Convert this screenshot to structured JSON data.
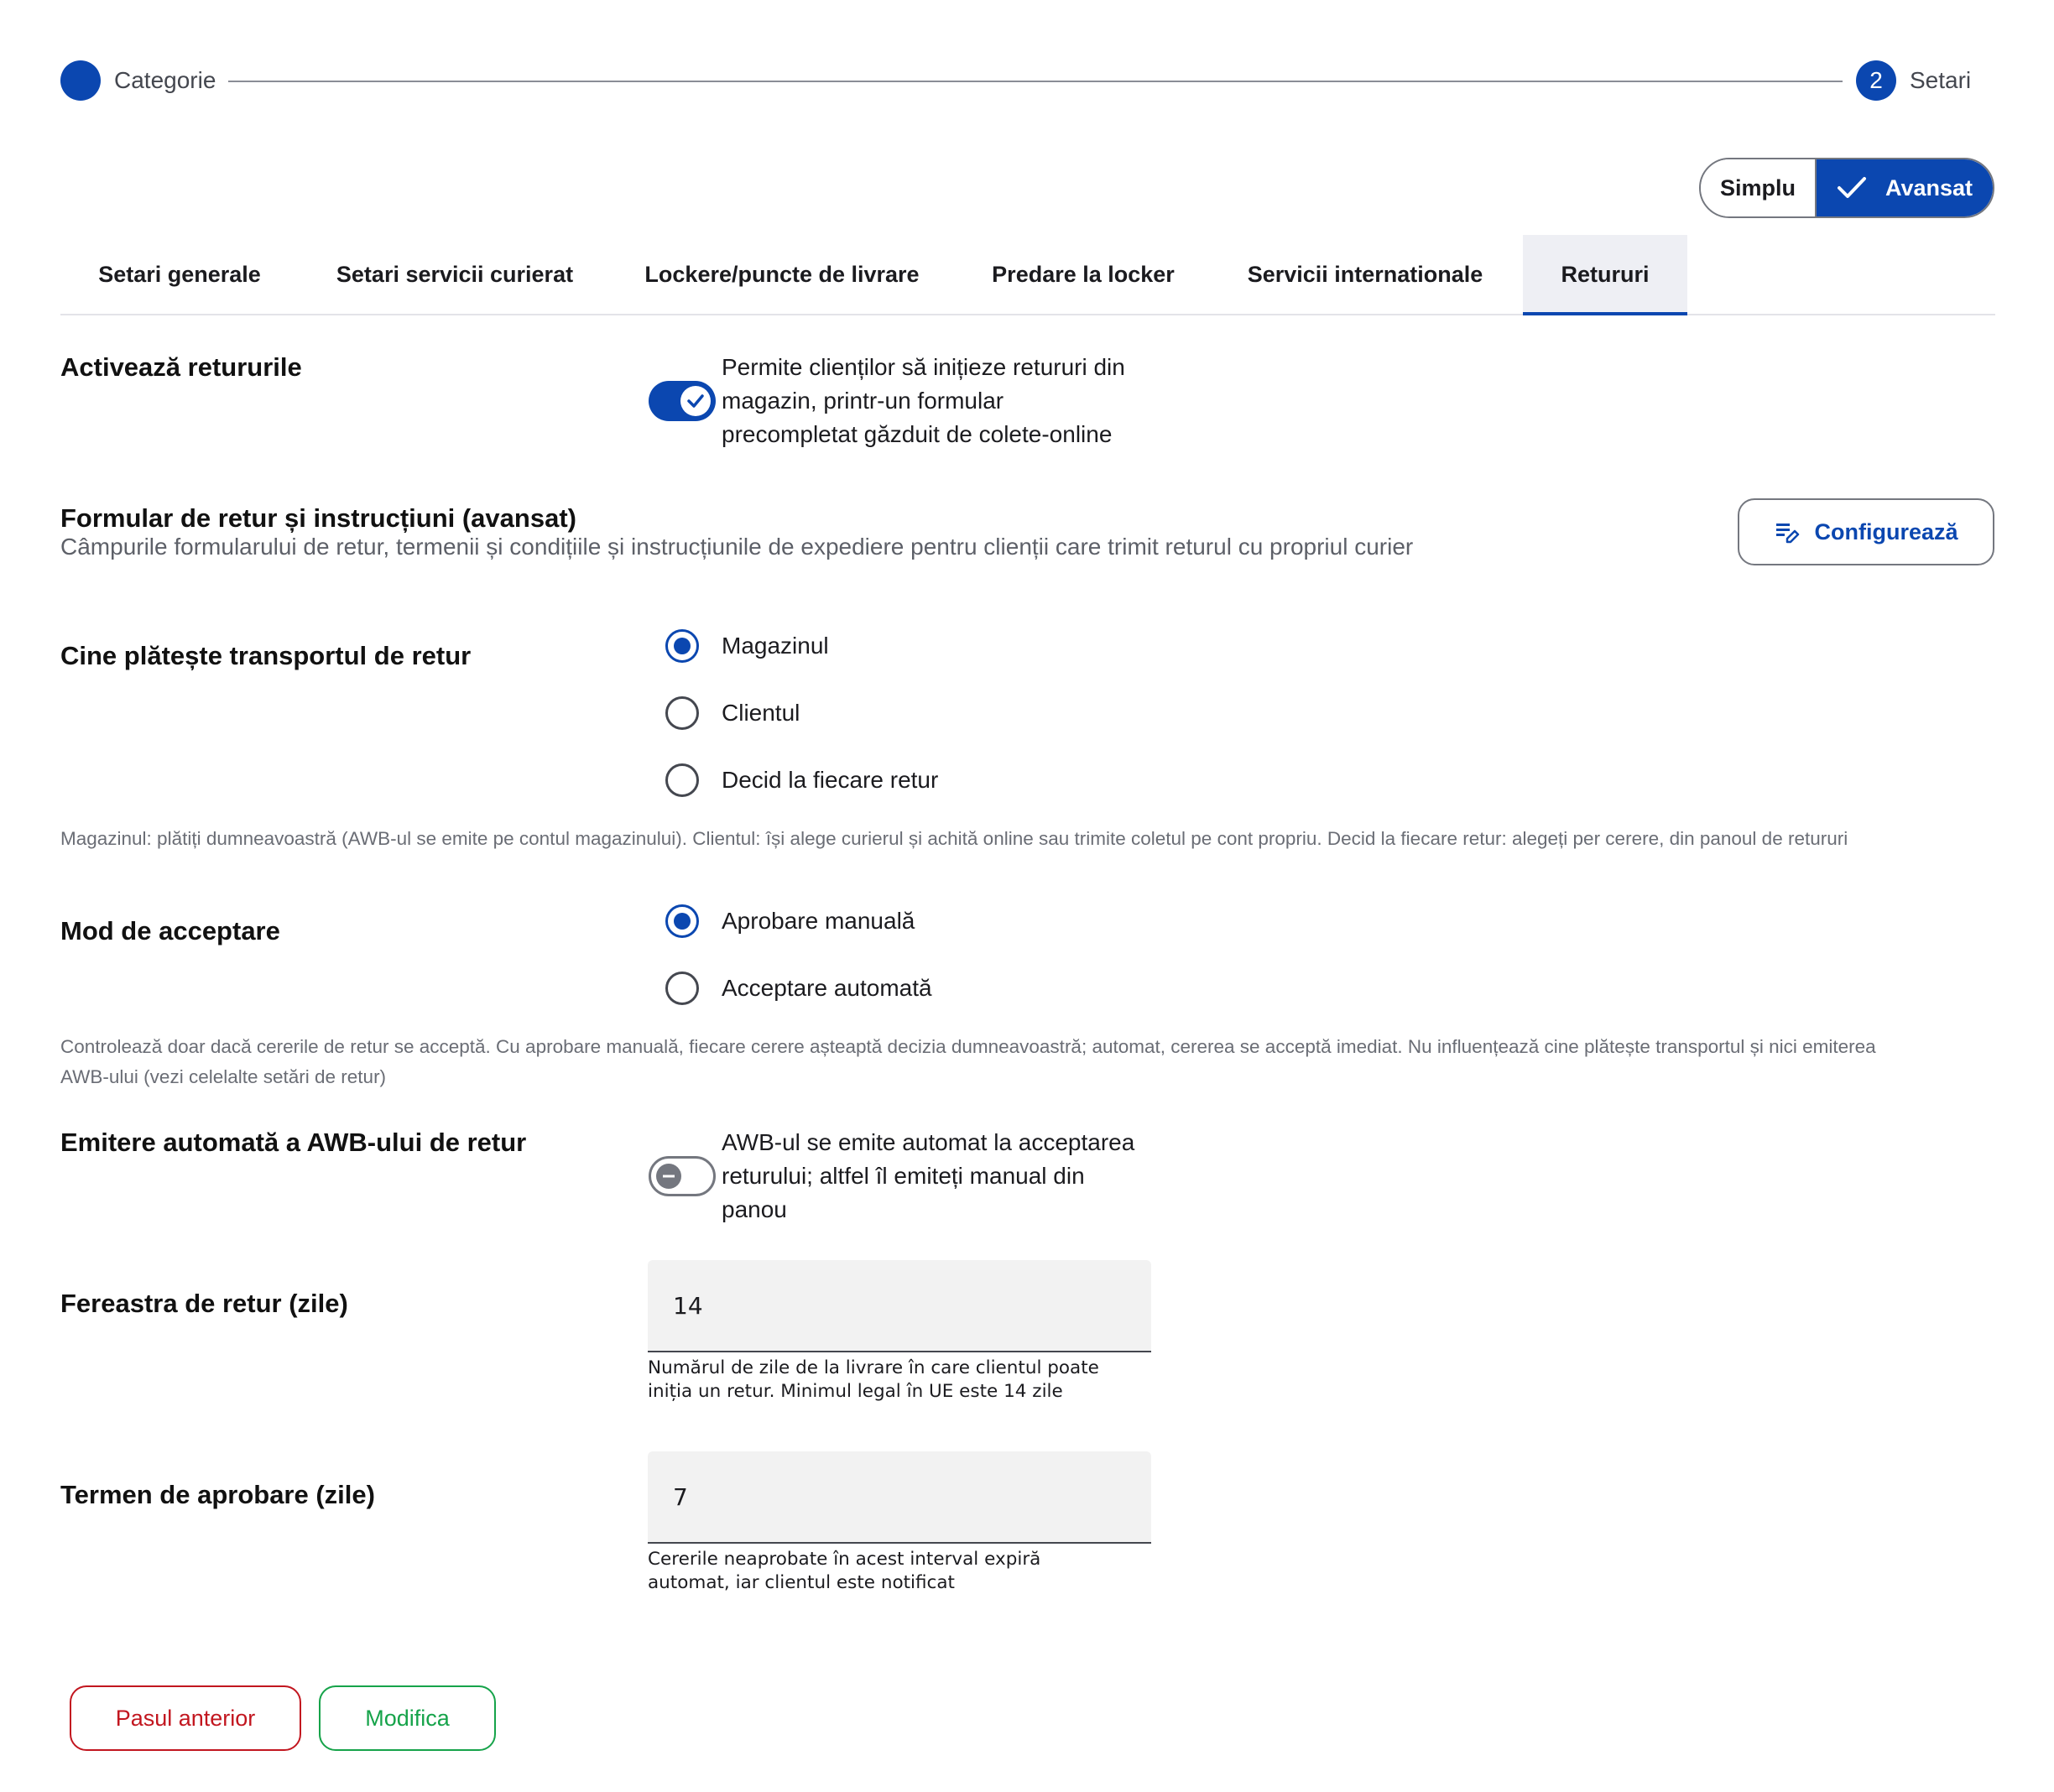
{
  "stepper": {
    "step1_label": "Categorie",
    "step2_number": "2",
    "step2_label": "Setari"
  },
  "mode_toggle": {
    "simple_label": "Simplu",
    "advanced_label": "Avansat",
    "selected": "Avansat"
  },
  "tabs": [
    {
      "label": "Setari generale",
      "active": false
    },
    {
      "label": "Setari servicii curierat",
      "active": false
    },
    {
      "label": "Lockere/puncte de livrare",
      "active": false
    },
    {
      "label": "Predare la locker",
      "active": false
    },
    {
      "label": "Servicii internationale",
      "active": false
    },
    {
      "label": "Retururi",
      "active": true
    }
  ],
  "enable_returns": {
    "title": "Activează retururile",
    "enabled": true,
    "description_lines": [
      "Permite clienților să inițieze retururi din",
      "magazin, printr-un formular",
      "precompletat găzduit de colete-online"
    ]
  },
  "return_form": {
    "title": "Formular de retur și instrucțiuni (avansat)",
    "description": "Câmpurile formularului de retur, termenii și condițiile și instrucțiunile de expediere pentru clienții care trimit returul cu propriul curier",
    "configure_button": "Configurează"
  },
  "shipping_payer": {
    "title": "Cine plătește transportul de retur",
    "options": [
      "Magazinul",
      "Clientul",
      "Decid la fiecare retur"
    ],
    "selected_index": 0,
    "help": "Magazinul: plătiți dumneavoastră (AWB-ul se emite pe contul magazinului). Clientul: își alege curierul și achită online sau trimite coletul pe cont propriu. Decid la fiecare retur: alegeți per cerere, din panoul de retururi"
  },
  "acceptance_mode": {
    "title": "Mod de acceptare",
    "options": [
      "Aprobare manuală",
      "Acceptare automată"
    ],
    "selected_index": 0,
    "help_lines": [
      "Controlează doar dacă cererile de retur se acceptă. Cu aprobare manuală, fiecare cerere așteaptă decizia dumneavoastră; automat, cererea se acceptă imediat. Nu influențează cine plătește transportul și nici emiterea",
      "AWB-ului (vezi celelalte setări de retur)"
    ]
  },
  "auto_awb": {
    "title": "Emitere automată a AWB-ului de retur",
    "enabled": false,
    "description_lines": [
      "AWB-ul se emite automat la acceptarea",
      "returului; altfel îl emiteți manual din",
      "panou"
    ]
  },
  "return_window": {
    "title": "Fereastra de retur (zile)",
    "value": "14",
    "help_lines": [
      "Numărul de zile de la livrare în care clientul poate",
      "iniția un retur. Minimul legal în UE este 14 zile"
    ]
  },
  "approval_term": {
    "title": "Termen de aprobare (zile)",
    "value": "7",
    "help_lines": [
      "Cererile neaprobate în acest interval expiră",
      "automat, iar clientul este notificat"
    ]
  },
  "footer": {
    "previous_label": "Pasul anterior",
    "modify_label": "Modifica"
  },
  "colors": {
    "primary": "#0b47b0",
    "danger": "#c2161f",
    "success": "#16a34a"
  }
}
